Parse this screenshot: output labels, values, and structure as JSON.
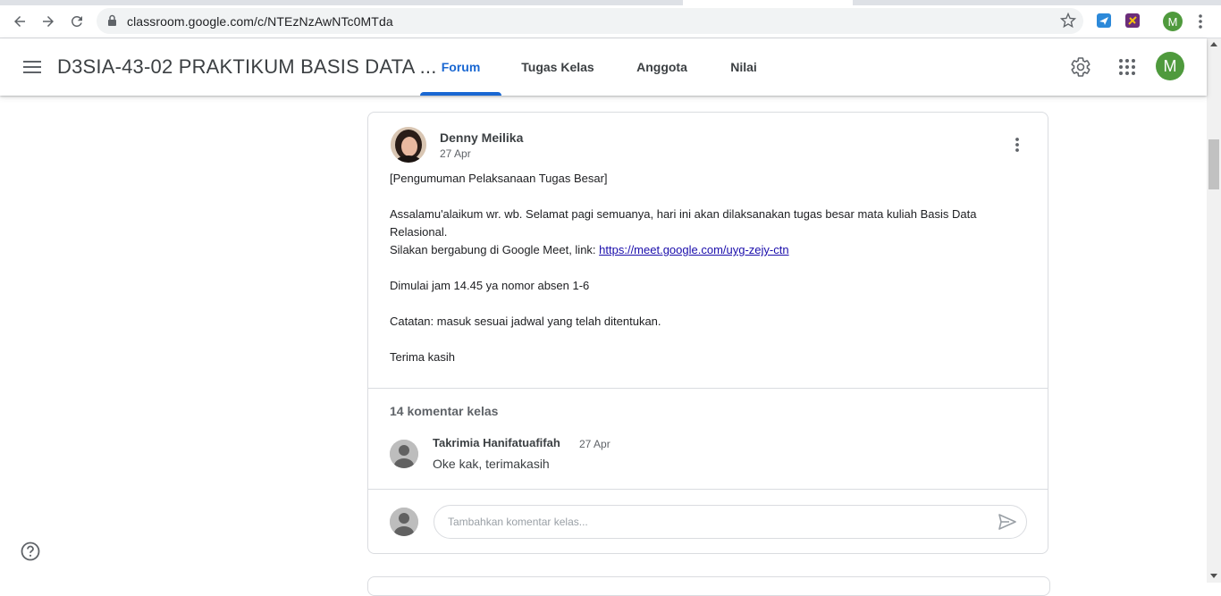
{
  "browser": {
    "url": "classroom.google.com/c/NTEzNzAwNTc0MTda",
    "profile_initial": "M",
    "icons": [
      "back-icon",
      "forward-icon",
      "reload-icon",
      "lock-icon",
      "star-icon",
      "extension-icon",
      "extension-icon",
      "more-vert-icon"
    ]
  },
  "header": {
    "class_title": "D3SIA-43-02 PRAKTIKUM BASIS DATA ...",
    "tabs": [
      {
        "label": "Forum",
        "active": true
      },
      {
        "label": "Tugas Kelas",
        "active": false
      },
      {
        "label": "Anggota",
        "active": false
      },
      {
        "label": "Nilai",
        "active": false
      }
    ],
    "avatar_initial": "M",
    "icons": [
      "menu-icon",
      "settings-icon",
      "apps-icon"
    ]
  },
  "post": {
    "author": "Denny Meilika",
    "date": "27 Apr",
    "lines": {
      "l1": "[Pengumuman Pelaksanaan Tugas Besar]",
      "l2": "Assalamu'alaikum wr. wb. Selamat pagi semuanya, hari ini akan dilaksanakan tugas besar mata kuliah Basis Data Relasional.",
      "l3": "Silakan bergabung di Google Meet, link: ",
      "link": "https://meet.google.com/uyg-zejy-ctn",
      "l4": "Dimulai jam 14.45 ya nomor absen 1-6",
      "l5": "Catatan: masuk sesuai jadwal yang telah ditentukan.",
      "l6": "Terima kasih"
    }
  },
  "comments": {
    "count_label": "14 komentar kelas",
    "items": [
      {
        "author": "Takrimia Hanifatuafifah",
        "date": "27 Apr",
        "text": "Oke kak, terimakasih"
      }
    ],
    "input_placeholder": "Tambahkan komentar kelas..."
  },
  "colors": {
    "accent": "#1967d2",
    "avatar_green": "#4f9a3d"
  }
}
